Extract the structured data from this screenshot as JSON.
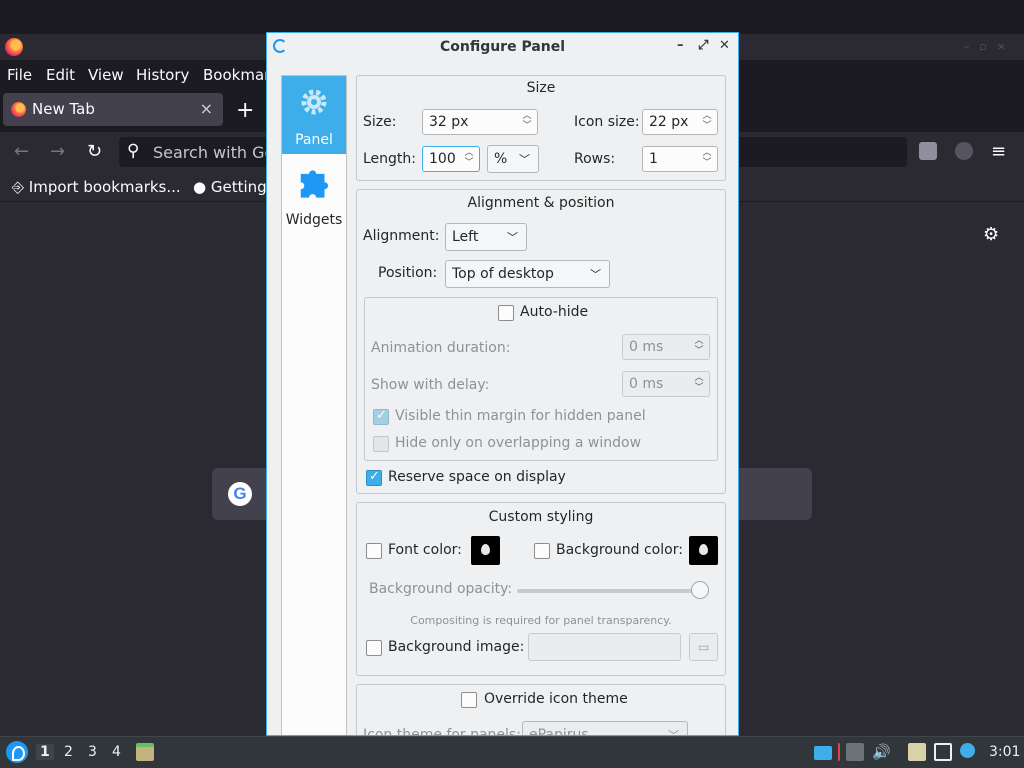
{
  "browser": {
    "menu": [
      "File",
      "Edit",
      "View",
      "History",
      "Bookmarks"
    ],
    "tab_label": "New Tab",
    "tab_close": "×",
    "new_tab": "+",
    "url_placeholder": "Search with Google or enter address",
    "bookmarks": [
      "Import bookmarks...",
      "Getting Started"
    ]
  },
  "dialog": {
    "title": "Configure Panel",
    "sidebar": [
      {
        "label": "Panel",
        "icon": "gear-icon",
        "active": true
      },
      {
        "label": "Widgets",
        "icon": "puzzle-icon",
        "active": false
      }
    ],
    "size_group": {
      "title": "Size",
      "size_label": "Size:",
      "size_value": "32 px",
      "icon_size_label": "Icon size:",
      "icon_size_value": "22 px",
      "length_label": "Length:",
      "length_value": "100",
      "length_unit": "%",
      "rows_label": "Rows:",
      "rows_value": "1"
    },
    "alignment_group": {
      "title": "Alignment & position",
      "alignment_label": "Alignment:",
      "alignment_value": "Left",
      "position_label": "Position:",
      "position_value": "Top of desktop",
      "autohide_label": "Auto-hide",
      "autohide_checked": false,
      "animation_label": "Animation duration:",
      "animation_value": "0 ms",
      "delay_label": "Show with delay:",
      "delay_value": "0 ms",
      "thin_margin_label": "Visible thin margin for hidden panel",
      "thin_margin_checked": true,
      "overlap_label": "Hide only on overlapping a window",
      "overlap_checked": false,
      "reserve_label": "Reserve space on display",
      "reserve_checked": true
    },
    "styling_group": {
      "title": "Custom styling",
      "font_color_label": "Font color:",
      "bg_color_label": "Background color:",
      "opacity_label": "Background opacity:",
      "opacity_value": 1.0,
      "compositing_note": "Compositing is required for panel transparency.",
      "bg_image_label": "Background image:"
    },
    "icon_theme_group": {
      "override_label": "Override icon theme",
      "theme_label": "Icon theme for panels:",
      "theme_value": "ePapirus"
    }
  },
  "taskbar": {
    "workspaces": [
      "1",
      "2",
      "3",
      "4"
    ],
    "active_workspace": "1",
    "clock": "3:01"
  },
  "colors": {
    "accent": "#3daee9",
    "dialog_bg": "#eff0f1",
    "browser_bg": "#2b2a33",
    "taskbar_bg": "#31363b"
  }
}
